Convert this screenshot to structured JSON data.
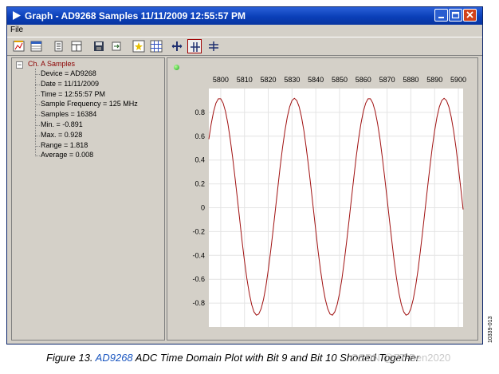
{
  "window": {
    "title": "Graph - AD9268 Samples 11/11/2009 12:55:57 PM"
  },
  "menu": {
    "file": "File"
  },
  "toolbar": {
    "buttons": [
      "chart-options",
      "table-view",
      "list-view",
      "split-view",
      "save",
      "export",
      "markers",
      "grid",
      "zoom-fit",
      "zoom-horizontal",
      "zoom-vertical"
    ],
    "active": "zoom-horizontal"
  },
  "tree": {
    "root": "Ch. A Samples",
    "items": [
      "Device = AD9268",
      "Date = 11/11/2009",
      "Time = 12:55:57 PM",
      "Sample Frequency = 125 MHz",
      "Samples = 16384",
      "Min. = -0.891",
      "Max. = 0.928",
      "Range = 1.818",
      "Average = 0.008"
    ]
  },
  "chart_data": {
    "type": "line",
    "xlim": [
      5795,
      5902
    ],
    "ylim": [
      -1.0,
      1.0
    ],
    "x_ticks": [
      5800,
      5810,
      5820,
      5830,
      5840,
      5850,
      5860,
      5870,
      5880,
      5890,
      5900
    ],
    "y_ticks": [
      0.8,
      0.6,
      0.4,
      0.2,
      0,
      -0.2,
      -0.4,
      -0.6,
      -0.8
    ],
    "x_axis_position": "top",
    "grid": true,
    "line_color": "#a01010",
    "series": [
      {
        "period": 31.5,
        "amplitude": 0.91,
        "offset": 0.008,
        "x_start": 5795,
        "x_end": 5902,
        "peaks_x": [
          5799.5,
          5831,
          5862.5,
          5894
        ]
      }
    ]
  },
  "caption": {
    "prefix": "Figure 13. ",
    "link": "AD9268",
    "rest": " ADC Time Domain Plot with Bit 9 and Bit 10 Shorted Together"
  },
  "side_code": "10339-013",
  "watermark": "CSDN @ZT-Ben2020"
}
